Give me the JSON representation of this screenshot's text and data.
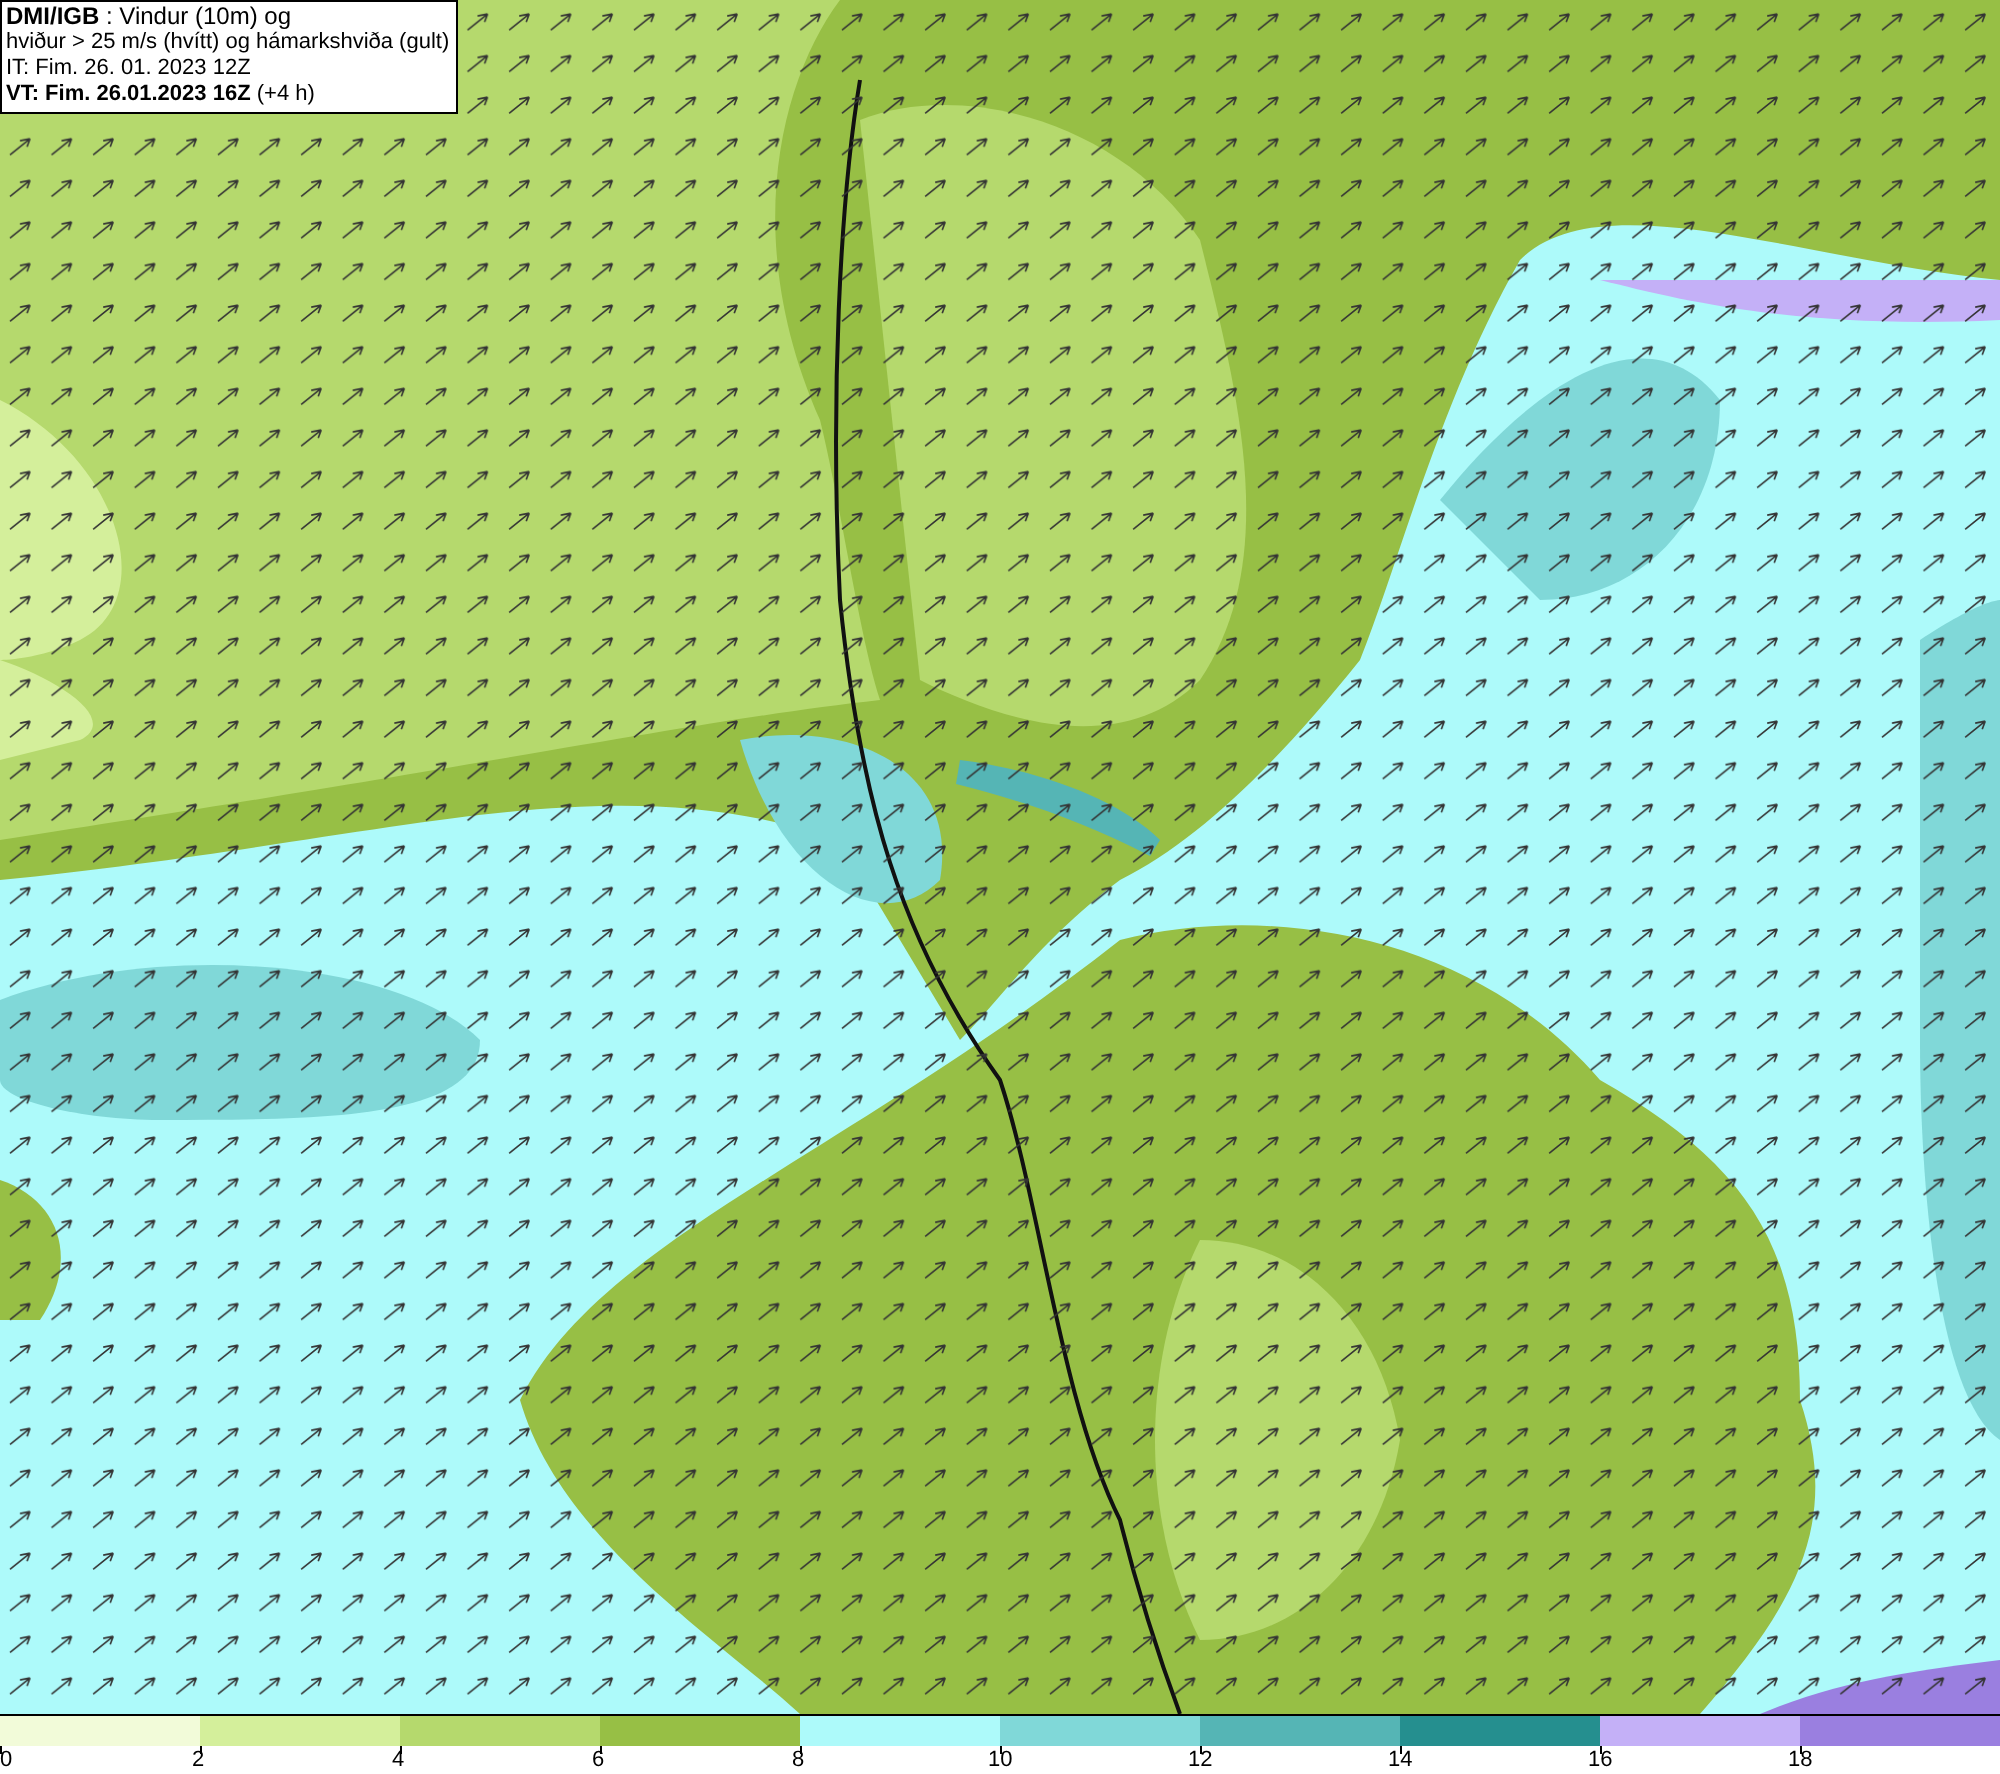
{
  "info_box": {
    "lines": [
      "**DMI/IGB** : Vindur (10m) og",
      "hviður > 25 m/s (hvítt) og hámarkshviða (gult)",
      "IT: Fim. 26. 01. 2023 12Z",
      "**VT: Fim. 26.01.2023 16Z** (+4 h)"
    ]
  },
  "legend": {
    "swatches": [
      {
        "label": "0",
        "color": "#f2fbd9"
      },
      {
        "label": "2",
        "color": "#d4ef9b"
      },
      {
        "label": "4",
        "color": "#b5d96d"
      },
      {
        "label": "6",
        "color": "#97bf45"
      },
      {
        "label": "8",
        "color": "#adfafa"
      },
      {
        "label": "10",
        "color": "#80d8d8"
      },
      {
        "label": "12",
        "color": "#55b5b5"
      },
      {
        "label": "14",
        "color": "#258f8f"
      },
      {
        "label": "16",
        "color": "#c4b0f7"
      },
      {
        "label": "18",
        "color": "#9a7fe0"
      }
    ]
  }
}
